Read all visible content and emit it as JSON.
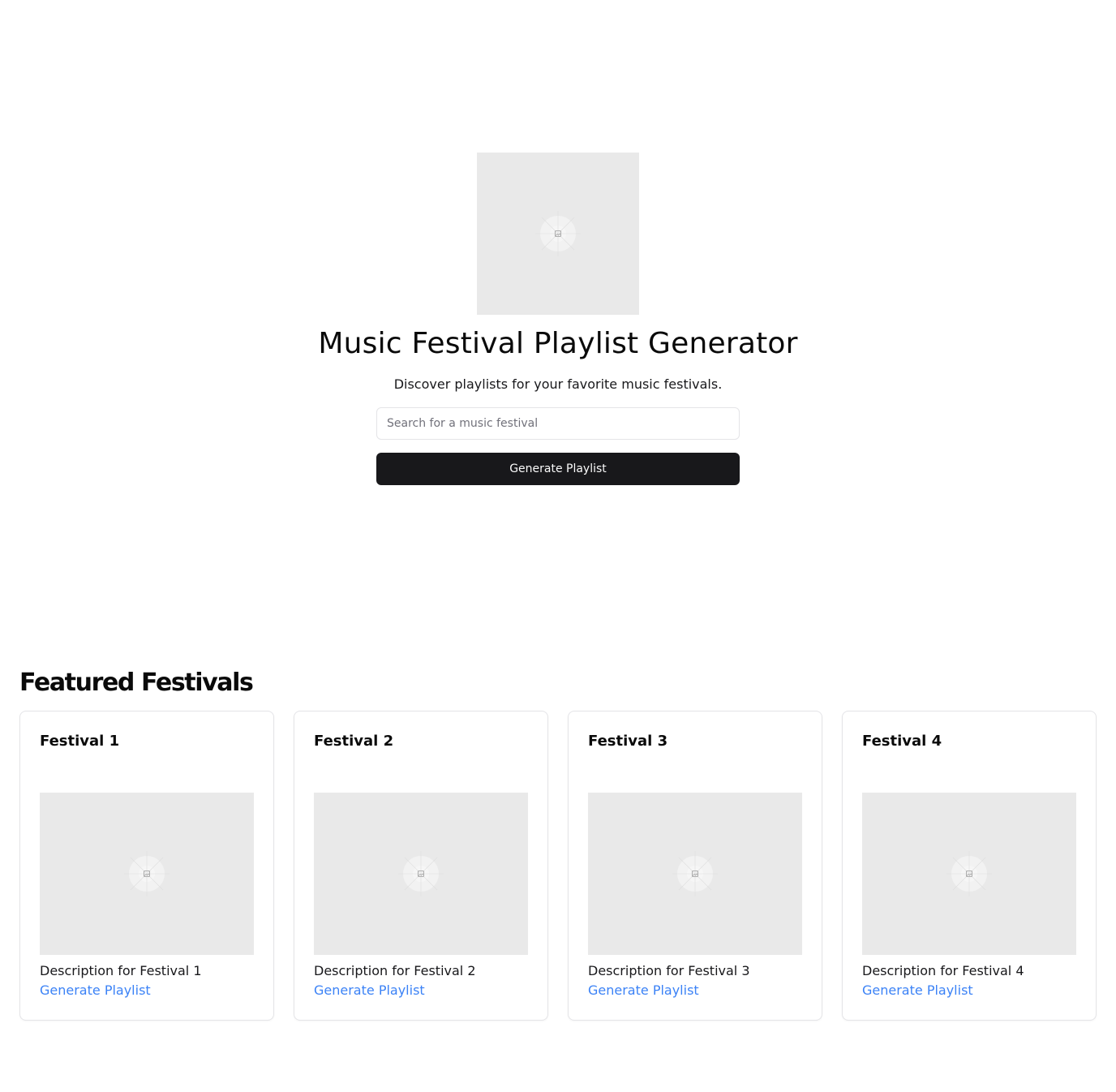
{
  "hero": {
    "title": "Music Festival Playlist Generator",
    "subtitle": "Discover playlists for your favorite music festivals.",
    "search_placeholder": "Search for a music festival",
    "button_label": "Generate Playlist"
  },
  "featured": {
    "title": "Featured Festivals",
    "cards": [
      {
        "title": "Festival 1",
        "description": "Description for Festival 1",
        "link_label": "Generate Playlist"
      },
      {
        "title": "Festival 2",
        "description": "Description for Festival 2",
        "link_label": "Generate Playlist"
      },
      {
        "title": "Festival 3",
        "description": "Description for Festival 3",
        "link_label": "Generate Playlist"
      },
      {
        "title": "Festival 4",
        "description": "Description for Festival 4",
        "link_label": "Generate Playlist"
      }
    ]
  },
  "icons": {
    "image_placeholder": "image-placeholder-icon"
  },
  "colors": {
    "primary_button": "#18181b",
    "link": "#3b82f6",
    "placeholder_bg": "#e9e9e9",
    "border": "#e4e4e7"
  }
}
